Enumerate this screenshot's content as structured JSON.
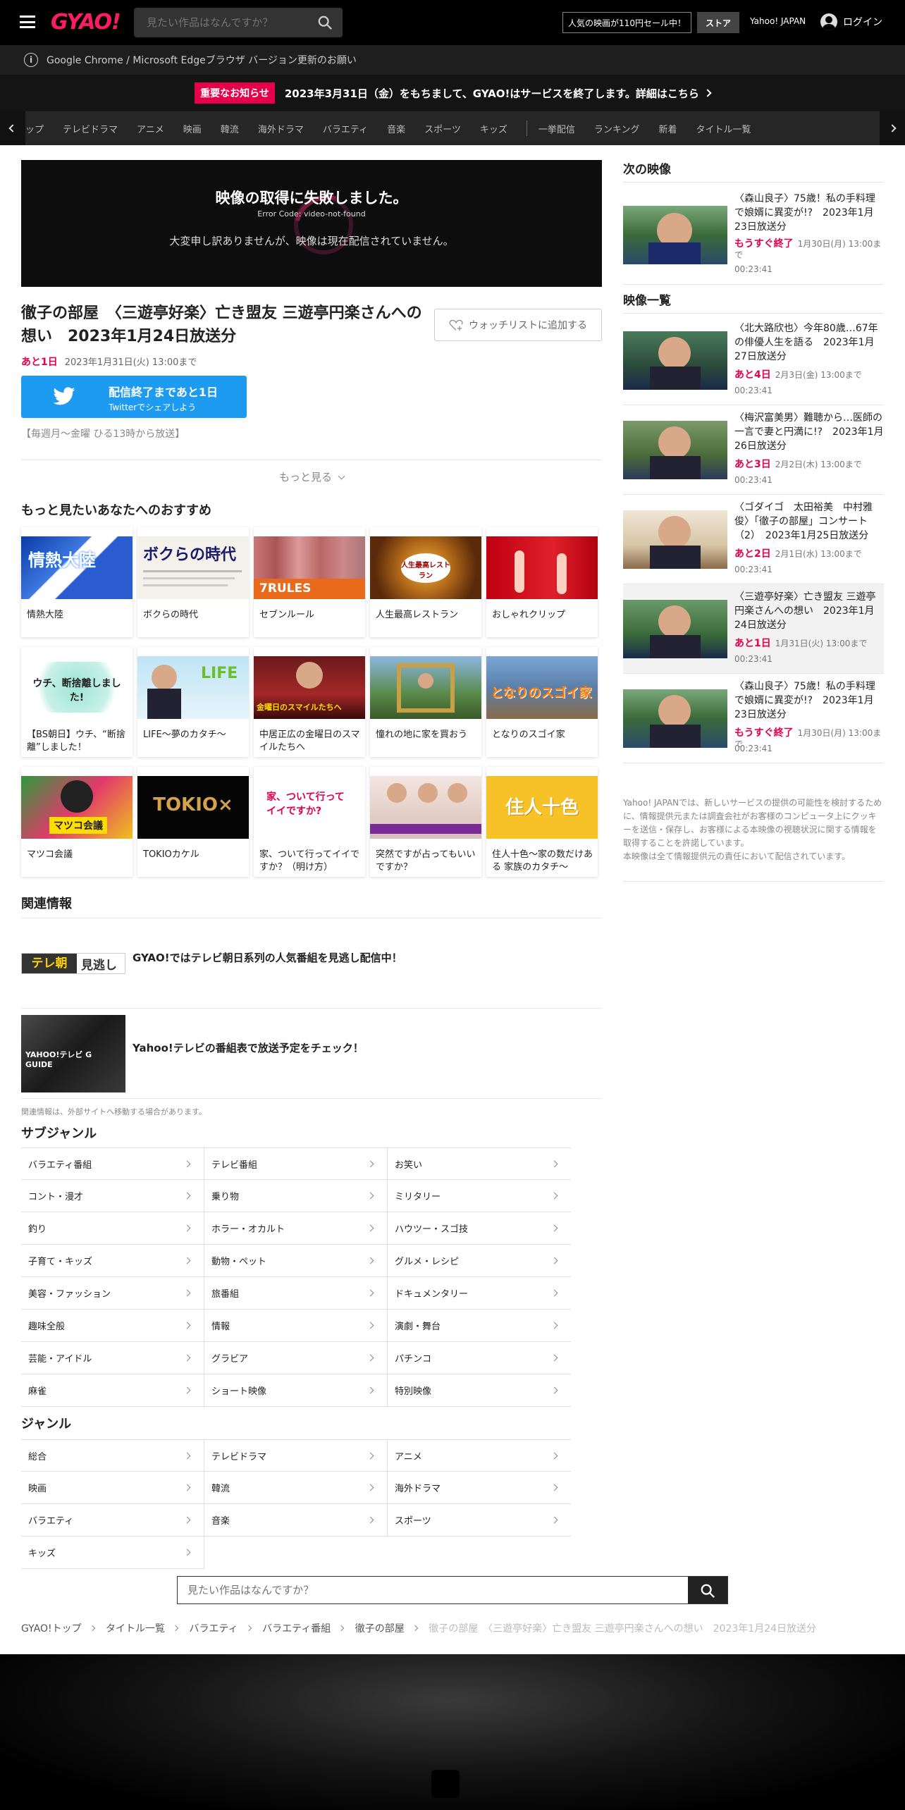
{
  "header": {
    "logo": "GYAO!",
    "search_placeholder": "見たい作品はなんですか？",
    "promo": "人気の映画が110円セール中！",
    "store": "ストア",
    "yahoo": "Yahoo! JAPAN",
    "login": "ログイン"
  },
  "notices": {
    "browser": "Google Chrome / Microsoft Edgeブラウザ バージョン更新のお願い",
    "important_badge": "重要なお知らせ",
    "important_text": "2023年3月31日（金）をもちまして、GYAO!はサービスを終了します。詳細はこちら"
  },
  "nav": {
    "items": [
      "ップ",
      "テレビドラマ",
      "アニメ",
      "映画",
      "韓流",
      "海外ドラマ",
      "バラエティ",
      "音楽",
      "スポーツ",
      "キッズ"
    ],
    "items2": [
      "一挙配信",
      "ランキング",
      "新着",
      "タイトル一覧"
    ]
  },
  "player": {
    "error_title": "映像の取得に失敗しました。",
    "error_code": "Error Code: video-not-found",
    "error_message": "大変申し訳ありませんが、映像は現在配信されていません。"
  },
  "episode": {
    "title": "徹子の部屋　〈三遊亭好楽〉亡き盟友 三遊亭円楽さんへの想い　2023年1月24日放送分",
    "watchlist": "ウォッチリストに追加する",
    "remain": "あと1日",
    "deadline": "2023年1月31日(火) 13:00まで",
    "twitter_line1": "配信終了まであと1日",
    "twitter_line2": "Twitterでシェアしよう",
    "broadcast": "【毎週月～金曜 ひる13時から放送】",
    "more": "もっと見る"
  },
  "recommend": {
    "title": "もっと見たいあなたへのおすすめ",
    "items": [
      {
        "label": "情熱大陸",
        "thumb_text": "情熱大陸"
      },
      {
        "label": "ボクらの時代",
        "thumb_text": "ボクらの時代"
      },
      {
        "label": "セブンルール",
        "thumb_text": "7RULES"
      },
      {
        "label": "人生最高レストラン",
        "thumb_text": "人生最高レストラン"
      },
      {
        "label": "おしゃれクリップ",
        "thumb_text": ""
      },
      {
        "label": "【BS朝日】ウチ、“断捨離”しました！",
        "thumb_text": "ウチ、断捨離しました!"
      },
      {
        "label": "LIFE～夢のカタチ～",
        "thumb_text": "LIFE"
      },
      {
        "label": "中居正広の金曜日のスマイルたちへ",
        "thumb_text": "金曜日のスマイルたちへ"
      },
      {
        "label": "憧れの地に家を買おう",
        "thumb_text": ""
      },
      {
        "label": "となりのスゴイ家",
        "thumb_text": "となりのスゴイ家"
      },
      {
        "label": "マツコ会議",
        "thumb_text": "マツコ会議"
      },
      {
        "label": "TOKIOカケル",
        "thumb_text": "TOKIO×"
      },
      {
        "label": "家、ついて行ってイイですか？（明け方）",
        "thumb_text": "家、ついて行ってイイですか?"
      },
      {
        "label": "突然ですが占ってもいいですか？",
        "thumb_text": ""
      },
      {
        "label": "住人十色～家の数だけある 家族のカタチ～",
        "thumb_text": "住人十色"
      }
    ]
  },
  "related": {
    "title": "関連情報",
    "items": [
      {
        "text": "GYAO!ではテレビ朝日系列の人気番組を見逃し配信中！",
        "logo": "テレ朝",
        "logo2": "見逃し"
      },
      {
        "text": "Yahoo!テレビの番組表で放送予定をチェック！",
        "logo": "YAHOO!テレビ G GUIDE"
      }
    ],
    "note": "関連情報は、外部サイトへ移動する場合があります。"
  },
  "subgenre": {
    "title": "サブジャンル",
    "items": [
      "バラエティ番組",
      "テレビ番組",
      "お笑い",
      "コント・漫才",
      "乗り物",
      "ミリタリー",
      "釣り",
      "ホラー・オカルト",
      "ハウツー・スゴ技",
      "子育て・キッズ",
      "動物・ペット",
      "グルメ・レシピ",
      "美容・ファッション",
      "旅番組",
      "ドキュメンタリー",
      "趣味全般",
      "情報",
      "演劇・舞台",
      "芸能・アイドル",
      "グラビア",
      "パチンコ",
      "麻雀",
      "ショート映像",
      "特別映像"
    ]
  },
  "genre": {
    "title": "ジャンル",
    "items": [
      "総合",
      "テレビドラマ",
      "アニメ",
      "映画",
      "韓流",
      "海外ドラマ",
      "バラエティ",
      "音楽",
      "スポーツ",
      "キッズ"
    ]
  },
  "bottom_search": {
    "placeholder": "見たい作品はなんですか？"
  },
  "breadcrumb": [
    "GYAO!トップ",
    "タイトル一覧",
    "バラエティ",
    "バラエティ番組",
    "徹子の部屋"
  ],
  "breadcrumb_current": "徹子の部屋　〈三遊亭好楽〉亡き盟友 三遊亭円楽さんへの想い　2023年1月24日放送分",
  "sidebar": {
    "next_title": "次の映像",
    "list_title": "映像一覧",
    "next": {
      "title": "〈森山良子〉75歳！私の手料理で娘婿に異変が!?　2023年1月23日放送分",
      "badge": "もうすぐ終了",
      "deadline": "1月30日(月) 13:00まで",
      "duration": "00:23:41"
    },
    "list": [
      {
        "title": "〈北大路欣也〉今年80歳…67年の俳優人生を語る　2023年1月27日放送分",
        "badge": "あと4日",
        "deadline": "2月3日(金) 13:00まで",
        "duration": "00:23:41"
      },
      {
        "title": "〈梅沢富美男〉難聴から…医師の一言で妻と円満に!?　2023年1月26日放送分",
        "badge": "あと3日",
        "deadline": "2月2日(木) 13:00まで",
        "duration": "00:23:41"
      },
      {
        "title": "〈ゴダイゴ　太田裕美　中村雅俊〉「徹子の部屋」コンサート（2）　2023年1月25日放送分",
        "badge": "あと2日",
        "deadline": "2月1日(水) 13:00まで",
        "duration": "00:23:41"
      },
      {
        "title": "〈三遊亭好楽〉亡き盟友 三遊亭円楽さんへの想い　2023年1月24日放送分",
        "badge": "あと1日",
        "deadline": "1月31日(火) 13:00まで",
        "duration": "00:23:41"
      },
      {
        "title": "〈森山良子〉75歳！私の手料理で娘婿に異変が!?　2023年1月23日放送分",
        "badge": "もうすぐ終了",
        "deadline": "1月30日(月) 13:00まで",
        "duration": "00:23:41"
      }
    ],
    "note": "Yahoo! JAPANでは、新しいサービスの提供の可能性を検討するために、情報提供元または調査会社がお客様のコンピュータ上にクッキーを送信・保存し、お客様による本映像の視聴状況に関する情報を取得することを許諾しています。\n本映像は全て情報提供元の責任において配信されています。"
  },
  "colors": {
    "accent": "#e6004c",
    "twitter": "#1d9bf0",
    "header_bg": "#000000"
  }
}
